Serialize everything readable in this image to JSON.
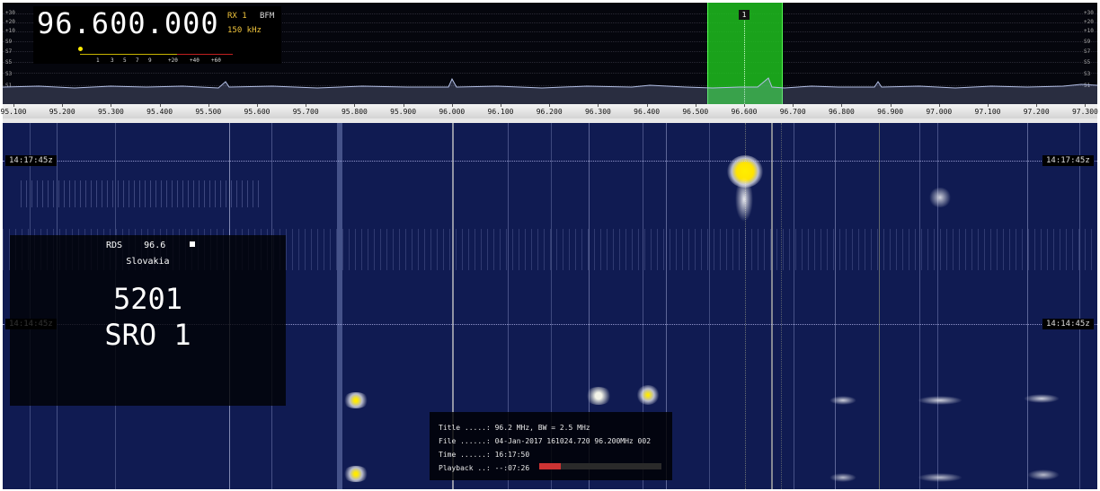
{
  "receiver": {
    "frequency": "96.600.000",
    "rx": "RX 1",
    "mode": "BFM",
    "bandwidth": "150 kHz"
  },
  "smeter": {
    "labels": [
      "1",
      "3",
      "5",
      "7",
      "9",
      "+20",
      "+40",
      "+60"
    ]
  },
  "db_scale": [
    "+30",
    "+20",
    "+10",
    "S9",
    "S7",
    "S5",
    "S3",
    "S1"
  ],
  "frequency_scale": [
    "95.100",
    "95.200",
    "95.300",
    "95.400",
    "95.500",
    "95.600",
    "95.700",
    "95.800",
    "95.900",
    "96.000",
    "96.100",
    "96.200",
    "96.300",
    "96.400",
    "96.500",
    "96.600",
    "96.700",
    "96.800",
    "96.900",
    "97.000",
    "97.100",
    "97.200",
    "97.300"
  ],
  "channel": {
    "label": "1",
    "center_mhz": 96.6,
    "width_khz": 150
  },
  "waterfall": {
    "times": [
      "14:17:45z",
      "14:14:45z"
    ]
  },
  "rds": {
    "label": "RDS",
    "frequency": "96.6",
    "country": "Slovakia",
    "pi_code": "5201",
    "ps_name": "SRO 1"
  },
  "recording": {
    "title": "Title .....: 96.2 MHz, BW = 2.5 MHz",
    "file": "File ......: 04-Jan-2017 161024.720 96.200MHz 002",
    "time": "Time ......: 16:17:50",
    "playback": "Playback ..: --:07:26",
    "playback_progress": 0.18
  },
  "colors": {
    "channel": "#1ebe1e",
    "waterfall_bg": "#101b52",
    "accent_yellow": "#f0c43c"
  }
}
